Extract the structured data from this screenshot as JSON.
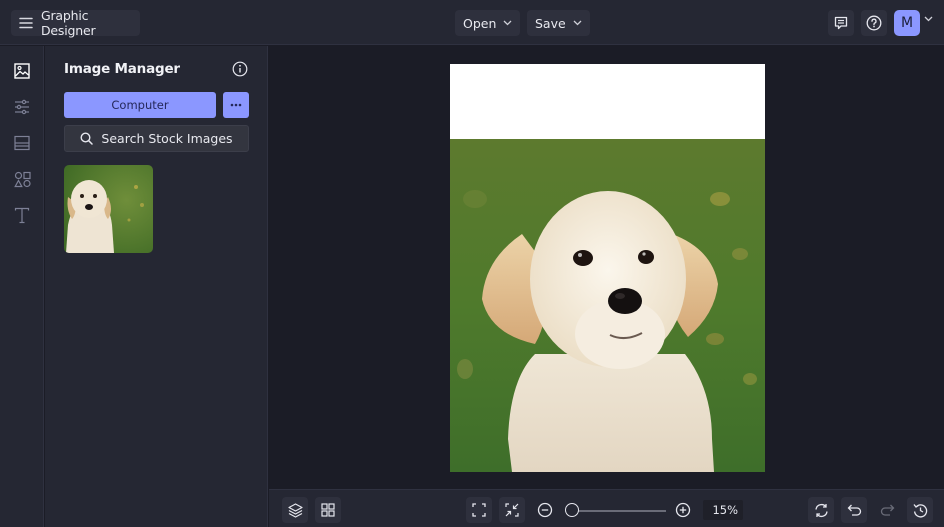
{
  "header": {
    "app_title": "Graphic Designer",
    "open_label": "Open",
    "save_label": "Save",
    "avatar_initial": "M",
    "icons": {
      "menu": "hamburger-icon",
      "feedback": "comment-icon",
      "help": "question-circle-icon",
      "avatar_menu": "chevron-down-icon"
    }
  },
  "rail": {
    "items": [
      {
        "name": "images",
        "icon": "image-icon",
        "active": true
      },
      {
        "name": "adjustments",
        "icon": "sliders-icon",
        "active": false
      },
      {
        "name": "layouts",
        "icon": "layout-icon",
        "active": false
      },
      {
        "name": "graphics",
        "icon": "shapes-icon",
        "active": false
      },
      {
        "name": "text",
        "icon": "text-icon",
        "active": false
      }
    ]
  },
  "panel": {
    "title": "Image Manager",
    "computer_label": "Computer",
    "more_label": "⋯",
    "search_stock_label": "Search Stock Images",
    "thumbnails": [
      {
        "alt": "Golden retriever puppy"
      }
    ]
  },
  "canvas": {
    "image_alt": "Golden retriever puppy sitting on grass"
  },
  "footer": {
    "zoom_percent": 15,
    "zoom_label": "15%",
    "buttons": {
      "layers": "layers-icon",
      "grid": "grid-icon",
      "fit": "fit-screen-icon",
      "shrink": "shrink-icon",
      "zoom_out": "zoom-out-icon",
      "zoom_in": "zoom-in-icon",
      "replace": "refresh-icon",
      "undo": "undo-icon",
      "redo": "redo-icon",
      "history": "history-icon"
    }
  },
  "colors": {
    "accent": "#8b97ff",
    "topbar_bg": "#252733",
    "workspace_bg": "#1b1c26",
    "button_bg": "#2e303d"
  }
}
